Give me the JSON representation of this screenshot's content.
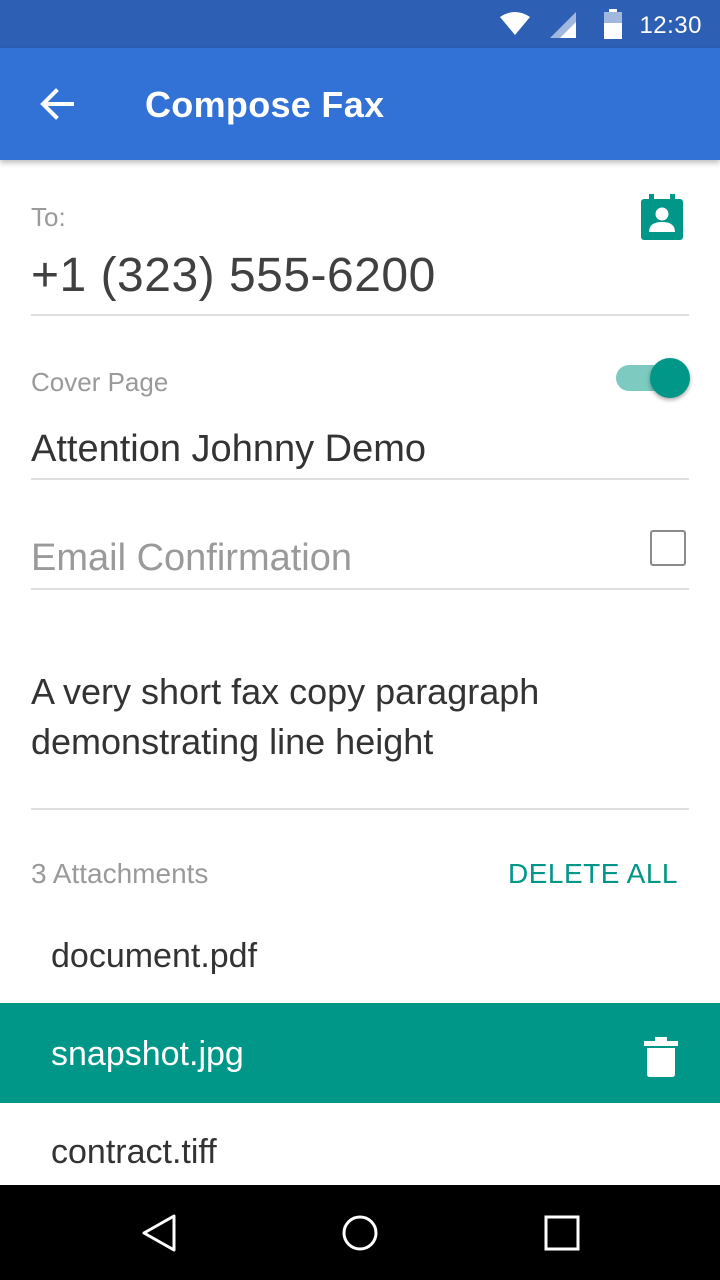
{
  "status_bar": {
    "time": "12:30",
    "icons": [
      "wifi-icon",
      "signal-icon",
      "battery-icon"
    ]
  },
  "app_bar": {
    "title": "Compose Fax",
    "back_icon": "arrow-back-icon"
  },
  "to": {
    "label": "To:",
    "value": "+1 (323) 555-6200",
    "contact_icon": "contact-book-icon"
  },
  "cover_page": {
    "label": "Cover Page",
    "enabled": true,
    "value": "Attention Johnny Demo"
  },
  "email_confirmation": {
    "label": "Email Confirmation",
    "checked": false
  },
  "message": {
    "text": "A very short fax copy paragraph demonstrating line height"
  },
  "attachments": {
    "count_label": "3 Attachments",
    "delete_all_label": "DELETE ALL",
    "items": [
      {
        "name": "document.pdf",
        "selected": false
      },
      {
        "name": "snapshot.jpg",
        "selected": true
      },
      {
        "name": "contract.tiff",
        "selected": false
      }
    ],
    "delete_icon": "trash-icon"
  },
  "nav_bar": {
    "icons": [
      "back-triangle-icon",
      "home-circle-icon",
      "recents-square-icon"
    ]
  },
  "colors": {
    "status_bar": "#2d5fb5",
    "app_bar": "#3271d6",
    "accent": "#009688",
    "toggle_track": "#7ccac0",
    "nav_bar": "#000000"
  }
}
